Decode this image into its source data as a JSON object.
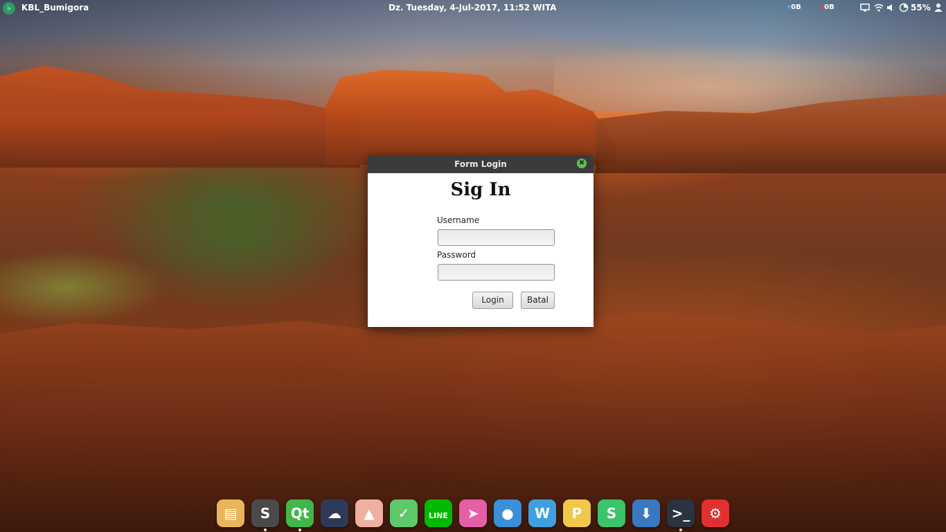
{
  "top_panel": {
    "logo_glyph": "♭",
    "hostname": "KBL_Bumigora",
    "clock": "Dz. Tuesday,  4-Jul-2017, 11:52 WITA",
    "net_down": "0B",
    "net_up": "0B",
    "battery": "55%",
    "tray_icons": [
      "monitor-icon",
      "wifi-icon",
      "volume-icon",
      "battery-icon",
      "user-icon"
    ]
  },
  "dialog": {
    "title": "Form Login",
    "close_glyph": "✖",
    "heading": "Sig In",
    "username": {
      "label": "Username",
      "value": "",
      "placeholder": ""
    },
    "password": {
      "label": "Password",
      "value": "",
      "placeholder": ""
    },
    "login_button": "Login",
    "cancel_button": "Batal"
  },
  "dock": {
    "items": [
      {
        "icon": "notes-app-icon",
        "glyph": "▤",
        "color": "#e9b45a"
      },
      {
        "icon": "sublime-text-icon",
        "glyph": "S",
        "color": "#4a4a4a"
      },
      {
        "icon": "qt-creator-icon",
        "glyph": "Qt",
        "color": "#41b649"
      },
      {
        "icon": "mysql-workbench-icon",
        "glyph": "☁",
        "color": "#2f3a5a"
      },
      {
        "icon": "inkscape-icon",
        "glyph": "▲",
        "color": "#f0b0a0"
      },
      {
        "icon": "calendar-icon",
        "glyph": "✓",
        "color": "#5ec86a"
      },
      {
        "icon": "line-messenger-icon",
        "glyph": "LINE",
        "color": "#00b900"
      },
      {
        "icon": "telegram-icon",
        "glyph": "➤",
        "color": "#e45fa8"
      },
      {
        "icon": "chromium-icon",
        "glyph": "●",
        "color": "#3a8fd8"
      },
      {
        "icon": "wps-writer-icon",
        "glyph": "W",
        "color": "#3ea0e0"
      },
      {
        "icon": "wps-presentation-icon",
        "glyph": "P",
        "color": "#f2c84b"
      },
      {
        "icon": "wps-spreadsheet-icon",
        "glyph": "S",
        "color": "#3cc46a"
      },
      {
        "icon": "installer-icon",
        "glyph": "⬇",
        "color": "#3a78c0"
      },
      {
        "icon": "terminal-icon",
        "glyph": ">_",
        "color": "#2c3340"
      },
      {
        "icon": "settings-icon",
        "glyph": "⚙",
        "color": "#e03030"
      }
    ]
  }
}
